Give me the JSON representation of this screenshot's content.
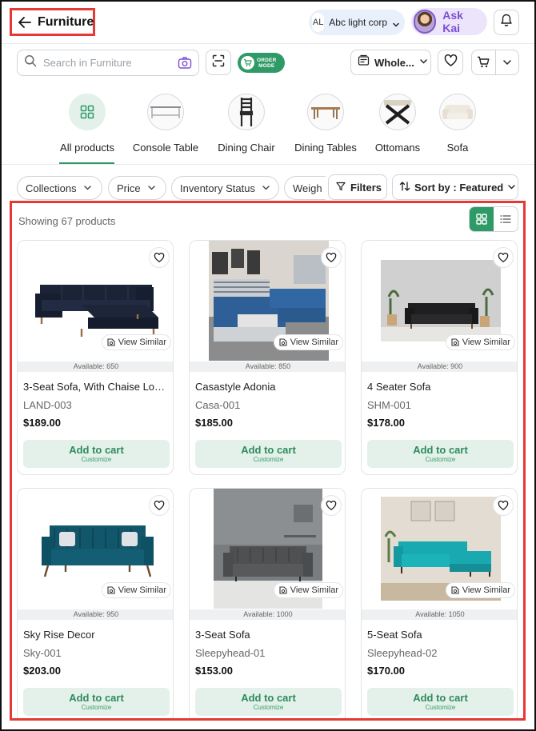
{
  "header": {
    "title": "Furniture",
    "org": {
      "initials": "AL",
      "name": "Abc light corp"
    },
    "assistant": {
      "label": "Ask Kai"
    }
  },
  "toolbar": {
    "search_placeholder": "Search in Furniture",
    "order_mode": {
      "line1": "ORDER",
      "line2": "MODE",
      "color": "#2e9a66"
    },
    "price_mode": "Whole..."
  },
  "categories": [
    {
      "label": "All products",
      "icon": "grid-icon",
      "active": true
    },
    {
      "label": "Console Table",
      "icon": "console-table-icon",
      "active": false
    },
    {
      "label": "Dining Chair",
      "icon": "dining-chair-icon",
      "active": false
    },
    {
      "label": "Dining Tables",
      "icon": "dining-table-icon",
      "active": false
    },
    {
      "label": "Ottomans",
      "icon": "ottoman-icon",
      "active": false
    },
    {
      "label": "Sofa",
      "icon": "sofa-icon",
      "active": false
    }
  ],
  "filters": {
    "chips": [
      "Collections",
      "Price",
      "Inventory Status",
      "Weigh"
    ],
    "filters_label": "Filters",
    "sort_label": "Sort by : Featured"
  },
  "results": {
    "showing": "Showing 67 products",
    "view_similar": "View Similar",
    "add_to_cart": "Add to cart",
    "customize": "Customize"
  },
  "products": [
    {
      "name": "3-Seat Sofa, With Chaise Long...",
      "sku": "LAND-003",
      "price": "$189.00",
      "available": "Available: 650",
      "image": "navy-chaise-sofa"
    },
    {
      "name": "Casastyle Adonia",
      "sku": "Casa-001",
      "price": "$185.00",
      "available": "Available: 850",
      "image": "blue-sectional-room"
    },
    {
      "name": "4 Seater Sofa",
      "sku": "SHM-001",
      "price": "$178.00",
      "available": "Available: 900",
      "image": "black-sofa-room"
    },
    {
      "name": "Sky Rise Decor",
      "sku": "Sky-001",
      "price": "$203.00",
      "available": "Available: 950",
      "image": "teal-sofa"
    },
    {
      "name": "3-Seat Sofa",
      "sku": "Sleepyhead-01",
      "price": "$153.00",
      "available": "Available: 1000",
      "image": "grey-sofa-room"
    },
    {
      "name": "5-Seat Sofa",
      "sku": "Sleepyhead-02",
      "price": "$170.00",
      "available": "Available: 1050",
      "image": "turquoise-sectional-room"
    }
  ],
  "colors": {
    "accent": "#2e9a66",
    "highlight": "#e53935",
    "assistant": "#7b4fd0"
  }
}
